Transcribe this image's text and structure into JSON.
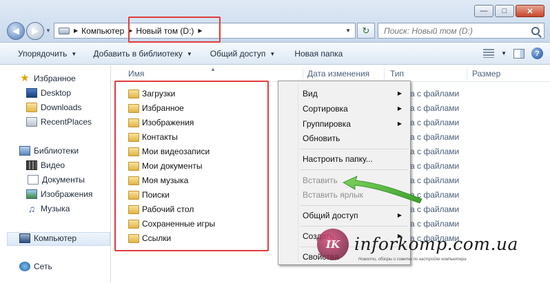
{
  "address": {
    "crumbs": [
      "Компьютер",
      "Новый том (D:)"
    ]
  },
  "search": {
    "placeholder": "Поиск: Новый том (D:)"
  },
  "toolbar": {
    "organize": "Упорядочить",
    "add_to_library": "Добавить в библиотеку",
    "share": "Общий доступ",
    "new_folder": "Новая папка"
  },
  "navpane": {
    "favorites": "Избранное",
    "desktop": "Desktop",
    "downloads": "Downloads",
    "recent_places": "RecentPlaces",
    "libraries": "Библиотеки",
    "video": "Видео",
    "documents": "Документы",
    "images": "Изображения",
    "music": "Музыка",
    "computer": "Компьютер",
    "network": "Сеть"
  },
  "columns": {
    "name": "Имя",
    "date": "Дата изменения",
    "type": "Тип",
    "size": "Размер"
  },
  "files": [
    "Загрузки",
    "Избранное",
    "Изображения",
    "Контакты",
    "Мои видеозаписи",
    "Мои документы",
    "Моя музыка",
    "Поиски",
    "Рабочий стол",
    "Сохраненные игры",
    "Ссылки"
  ],
  "file_type_visible": "а с файлами",
  "context_menu": {
    "view": "Вид",
    "sort": "Сортировка",
    "group": "Группировка",
    "refresh": "Обновить",
    "customize": "Настроить папку...",
    "paste": "Вставить",
    "paste_shortcut": "Вставить ярлык",
    "share": "Общий доступ",
    "create": "Создать",
    "properties": "Свойства"
  },
  "watermark": {
    "logo": "IK",
    "site": "inforkomp.com.ua",
    "tagline": "Новости, обзоры и советы по настройке компьютера"
  },
  "colors": {
    "highlight_box": "#e03c3c",
    "arrow": "#4fb83a"
  }
}
